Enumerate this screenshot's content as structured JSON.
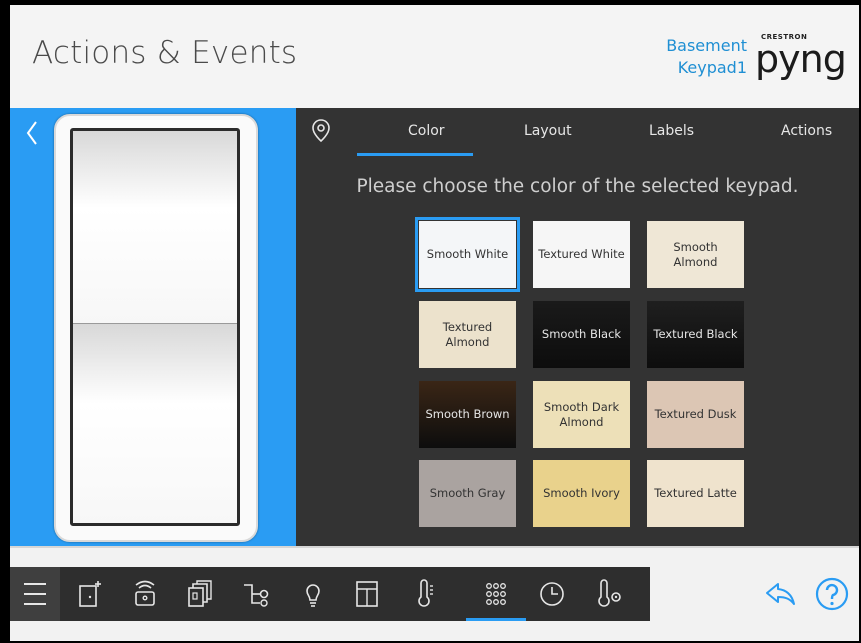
{
  "header": {
    "title": "Actions & Events",
    "location_line1": "Basement",
    "location_line2": "Keypad1",
    "brand_small": "CRESTRON",
    "brand_logo": "pyng"
  },
  "tabs": [
    {
      "label": "Color",
      "active": true
    },
    {
      "label": "Layout",
      "active": false
    },
    {
      "label": "Labels",
      "active": false
    },
    {
      "label": "Actions",
      "active": false
    }
  ],
  "prompt": "Please choose the color of the selected keypad.",
  "swatches": [
    {
      "label": "Smooth White",
      "selected": true,
      "bg": "#f4f6f8",
      "fg": "#333333"
    },
    {
      "label": "Textured White",
      "bg": "#f6f6f6",
      "fg": "#333333"
    },
    {
      "label": "Smooth Almond",
      "bg": "#efe7d6",
      "fg": "#333333"
    },
    {
      "label": "Textured Almond",
      "bg": "#ece2cc",
      "fg": "#333333"
    },
    {
      "label": "Smooth Black",
      "bg": "#1a1a1a",
      "fg": "#e6e6e6"
    },
    {
      "label": "Textured Black",
      "bg": "#1f1f1f",
      "fg": "#e6e6e6"
    },
    {
      "label": "Smooth Brown",
      "bg": "#3a2616",
      "fg": "#e6e6e6"
    },
    {
      "label": "Smooth Dark Almond",
      "bg": "#ede0b8",
      "fg": "#333333"
    },
    {
      "label": "Textured Dusk",
      "bg": "#dcc6b4",
      "fg": "#333333"
    },
    {
      "label": "Smooth Gray",
      "bg": "#aaa3a0",
      "fg": "#333333"
    },
    {
      "label": "Smooth Ivory",
      "bg": "#e9d28c",
      "fg": "#333333"
    },
    {
      "label": "Textured Latte",
      "bg": "#efe3cd",
      "fg": "#333333"
    }
  ],
  "colors": {
    "accent": "#2a9cf3",
    "panel": "#333333",
    "navbar": "#2e2e2e"
  },
  "navbar_icons": [
    "menu-icon",
    "add-room-icon",
    "remote-icon",
    "panels-icon",
    "flow-icon",
    "bulb-icon",
    "door-icon",
    "thermometer-icon",
    "keypad-icon",
    "clock-icon",
    "temperature-settings-icon"
  ],
  "active_nav": "keypad-icon"
}
